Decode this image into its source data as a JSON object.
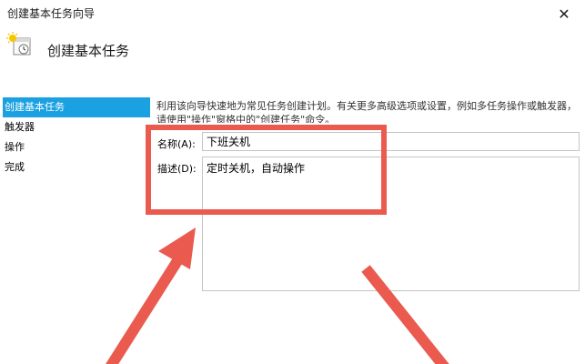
{
  "window": {
    "title": "创建基本任务向导",
    "close_glyph": "✕"
  },
  "header": {
    "title": "创建基本任务",
    "icon": "task-scheduler-icon"
  },
  "sidebar": {
    "items": [
      {
        "label": "创建基本任务",
        "active": true
      },
      {
        "label": "触发器",
        "active": false
      },
      {
        "label": "操作",
        "active": false
      },
      {
        "label": "完成",
        "active": false
      }
    ]
  },
  "main": {
    "description": "利用该向导快速地为常见任务创建计划。有关更多高级选项或设置，例如多任务操作或触发器，请使用\"操作\"窗格中的\"创建任务\"命令。",
    "name_label": "名称(A):",
    "name_value": "下班关机",
    "desc_label": "描述(D):",
    "desc_value": "定时关机，自动操作"
  },
  "annotation": {
    "color": "#ea5a4f"
  }
}
